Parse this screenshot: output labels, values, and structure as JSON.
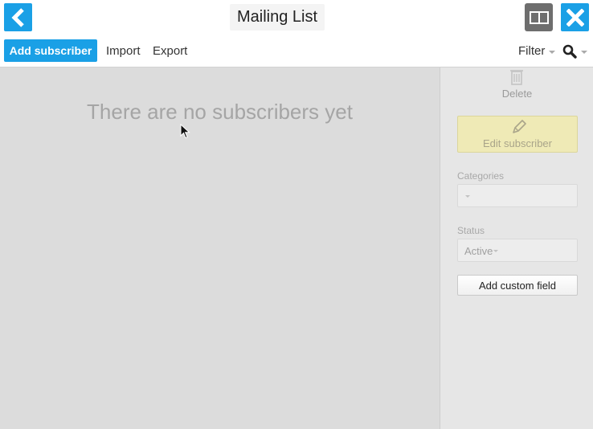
{
  "header": {
    "title": "Mailing List",
    "back_icon": "chevron-left-icon",
    "view_icon": "split-view-icon",
    "close_icon": "close-icon"
  },
  "toolbar": {
    "add_label": "Add subscriber",
    "import_label": "Import",
    "export_label": "Export",
    "filter_label": "Filter",
    "search_icon": "search-icon"
  },
  "main": {
    "empty_message": "There are no subscribers yet"
  },
  "side_panel": {
    "delete_label": "Delete",
    "edit_label": "Edit subscriber",
    "categories_label": "Categories",
    "categories_value": "",
    "status_label": "Status",
    "status_value": "Active",
    "custom_field_label": "Add custom field"
  },
  "colors": {
    "accent": "#1aa0e6",
    "edit_button_bg": "#efeab6",
    "main_bg": "#dcdcdc",
    "side_bg": "#e6e6e6"
  }
}
